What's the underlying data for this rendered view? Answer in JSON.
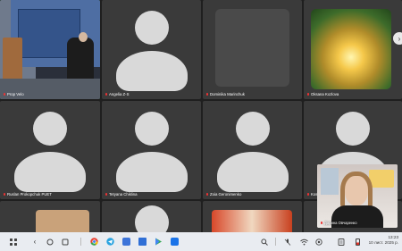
{
  "participants": [
    {
      "name": "Prop Velo",
      "kind": "video",
      "active": true
    },
    {
      "name": "Angelia Z-S",
      "kind": "avatar"
    },
    {
      "name": "Dominika Marinchuk",
      "kind": "placeholder"
    },
    {
      "name": "Oksana Kozlova",
      "kind": "image"
    },
    {
      "name": "Ruslan Prokopchuk PUET",
      "kind": "avatar"
    },
    {
      "name": "Tetyana Chiklina",
      "kind": "avatar"
    },
    {
      "name": "Zoia Geronimenko",
      "kind": "avatar"
    },
    {
      "name": "Kosa...",
      "kind": "avatar"
    }
  ],
  "self_view": {
    "name": "Дарина Овчаренко"
  },
  "taskbar": {
    "time": "13:23",
    "date": "10 лист. 2025 р.",
    "apps": [
      "chrome-icon",
      "telegram-icon",
      "messages-icon",
      "files-icon",
      "play-store-icon",
      "meet-icon"
    ]
  },
  "colors": {
    "active_border": "#29c46b",
    "tile_bg": "#3a3a3a",
    "mic_muted": "#e33333"
  }
}
